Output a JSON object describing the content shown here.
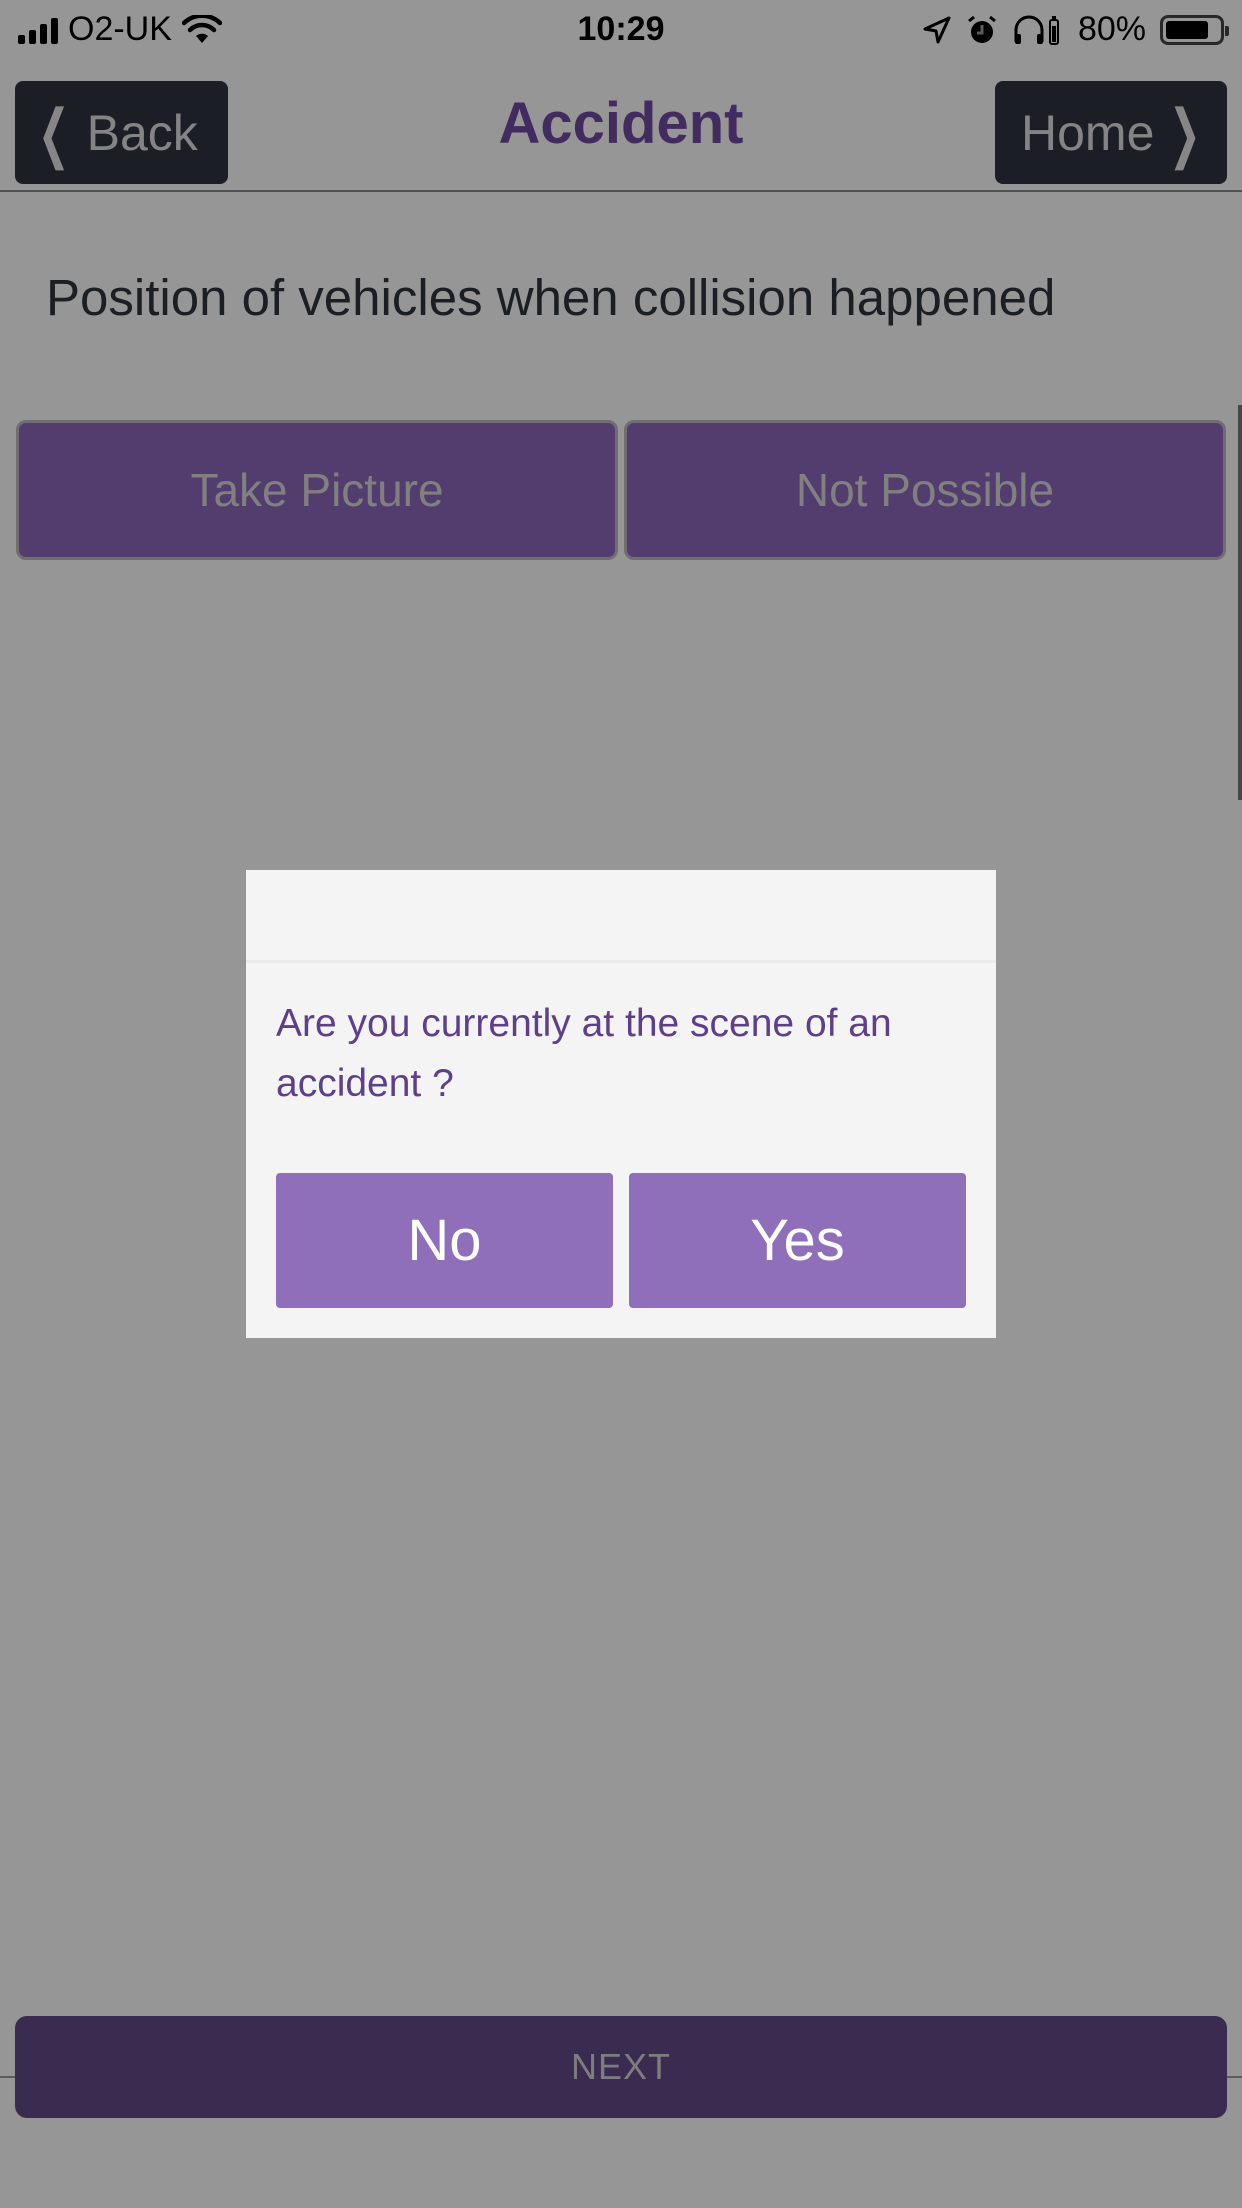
{
  "status_bar": {
    "carrier": "O2-UK",
    "time": "10:29",
    "battery_percent": "80%",
    "battery_level": 0.8,
    "icons": [
      "signal-icon",
      "wifi-icon",
      "location-icon",
      "alarm-icon",
      "headphones-icon",
      "battery-icon"
    ]
  },
  "nav": {
    "back_label": "Back",
    "title": "Accident",
    "home_label": "Home"
  },
  "page": {
    "heading": "Position of vehicles when collision happened",
    "take_picture_label": "Take Picture",
    "not_possible_label": "Not Possible",
    "next_label": "NEXT"
  },
  "modal": {
    "title": "",
    "message": "Are you currently at the scene of an accident ?",
    "no_label": "No",
    "yes_label": "Yes"
  },
  "colors": {
    "brand_purple": "#6f4a9e",
    "modal_button": "#8f6fba",
    "modal_text": "#5d3f8c",
    "nav_button": "#2d333d"
  }
}
